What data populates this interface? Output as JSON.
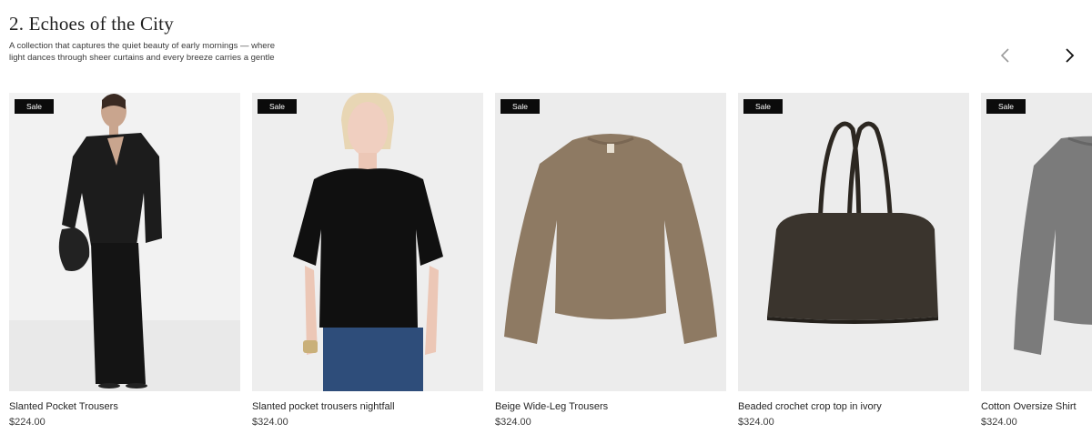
{
  "section": {
    "title": "2. Echoes of the City",
    "description": "A collection that captures the quiet beauty of early mornings — where light dances through sheer curtains and every breeze carries a gentle"
  },
  "navigation": {
    "prev_icon": "chevron-left-icon",
    "next_icon": "chevron-right-icon"
  },
  "products": [
    {
      "badge": "Sale",
      "name": "Slanted Pocket Trousers",
      "price": "$224.00"
    },
    {
      "badge": "Sale",
      "name": "Slanted pocket trousers nightfall",
      "price": "$324.00"
    },
    {
      "badge": "Sale",
      "name": "Beige Wide-Leg Trousers",
      "price": "$324.00"
    },
    {
      "badge": "Sale",
      "name": "Beaded crochet crop top in ivory",
      "price": "$324.00"
    },
    {
      "badge": "Sale",
      "name": "Cotton Oversize Shirt",
      "price": "$324.00"
    }
  ]
}
